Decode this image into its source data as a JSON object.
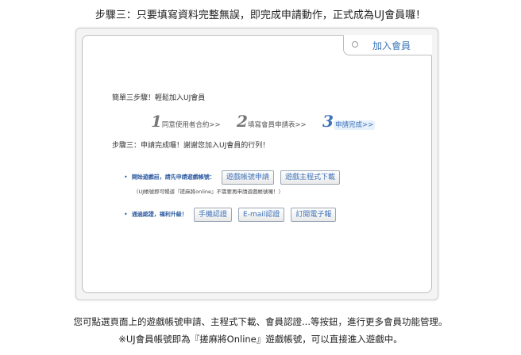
{
  "caption_top": "步驟三：只要填寫資料完整無誤，即完成申請動作，正式成為UJ會員囉！",
  "tab": {
    "label": "加入會員"
  },
  "intro": "簡單三步驟！輕鬆加入UJ會員",
  "steps": [
    {
      "num": "1",
      "label": "同意使用者合約>>"
    },
    {
      "num": "2",
      "label": "填寫會員申請表>>"
    },
    {
      "num": "3",
      "label": "申請完成>>"
    }
  ],
  "complete_text": "步驟三：申請完成囉！謝謝您加入UJ會員的行列！",
  "row1": {
    "lead": "開始遊戲前，請先申請遊戲帳號：",
    "buttons": [
      "遊戲帳號申請",
      "遊戲主程式下載"
    ]
  },
  "note": "（UJ帳號即可暢遊『搓麻將online』不需要再申請遊戲帳號囉！）",
  "row2": {
    "lead": "通過認證，福利升級！",
    "buttons": [
      "手機認證",
      "E-mail認證",
      "訂閱電子報"
    ]
  },
  "caption_bottom1": "您可點選頁面上的遊戲帳號申請、主程式下載、會員認證...等按鈕，進行更多會員功能管理。",
  "caption_bottom2": "※UJ會員帳號即為『搓麻將Online』遊戲帳號，可以直接進入遊戲中。"
}
